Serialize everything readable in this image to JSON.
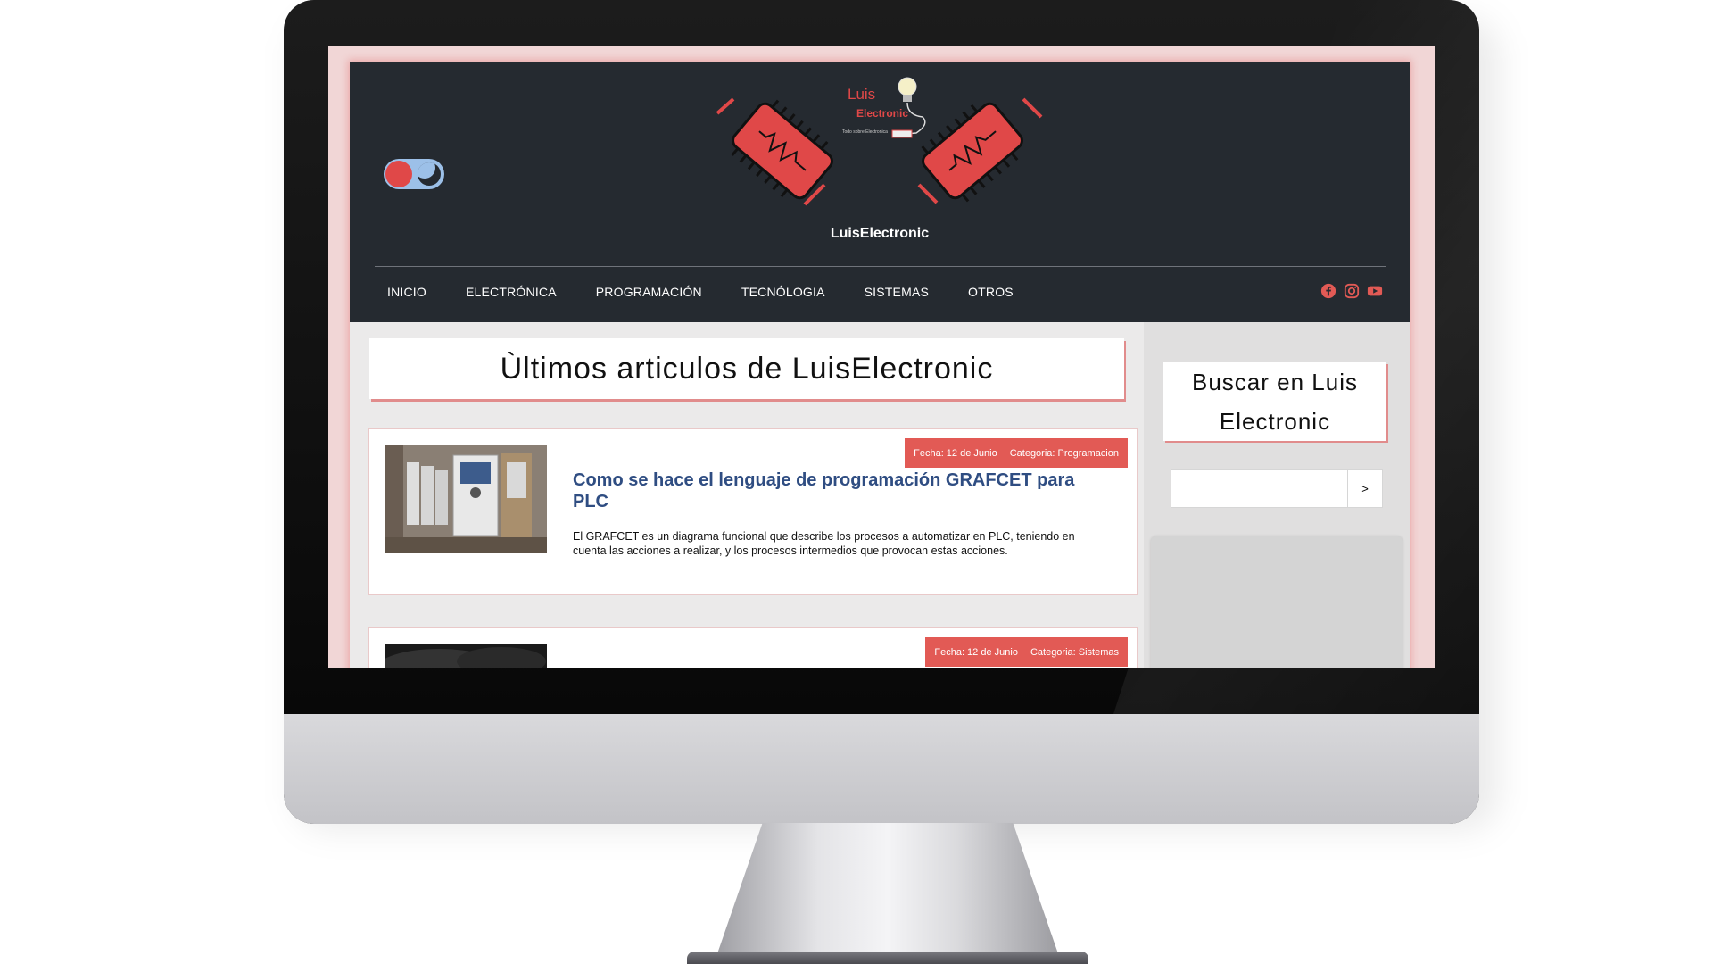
{
  "header": {
    "logo_line1": "Luis",
    "logo_line2": "Electronic",
    "logo_tagline": "Todo sobre Electronica",
    "site_name": "LuisElectronic"
  },
  "nav": {
    "items": [
      "INICIO",
      "ELECTRÓNICA",
      "PROGRAMACIÓN",
      "TECNÓLOGIA",
      "SISTEMAS",
      "OTROS"
    ]
  },
  "social": {
    "icons": [
      "facebook-icon",
      "instagram-icon",
      "youtube-icon"
    ],
    "color": "#e25a55"
  },
  "main": {
    "title": "Ùltimos articulos de LuisElectronic",
    "articles": [
      {
        "date": "Fecha: 12 de Junio",
        "category": "Categoria: Programacion",
        "title": "Como se hace el lenguaje de programación GRAFCET para PLC",
        "excerpt": "El GRAFCET es un diagrama funcional que describe los procesos a automatizar en PLC, teniendo en cuenta las acciones a realizar, y los procesos intermedios que provocan estas acciones."
      },
      {
        "date": "Fecha: 12 de Junio",
        "category": "Categoria: Sistemas"
      }
    ]
  },
  "sidebar": {
    "search_title": "Buscar en Luis Electronic",
    "search_button": ">"
  },
  "colors": {
    "accent": "#e25a55",
    "header_bg": "#252a30",
    "link": "#2f4d82"
  }
}
